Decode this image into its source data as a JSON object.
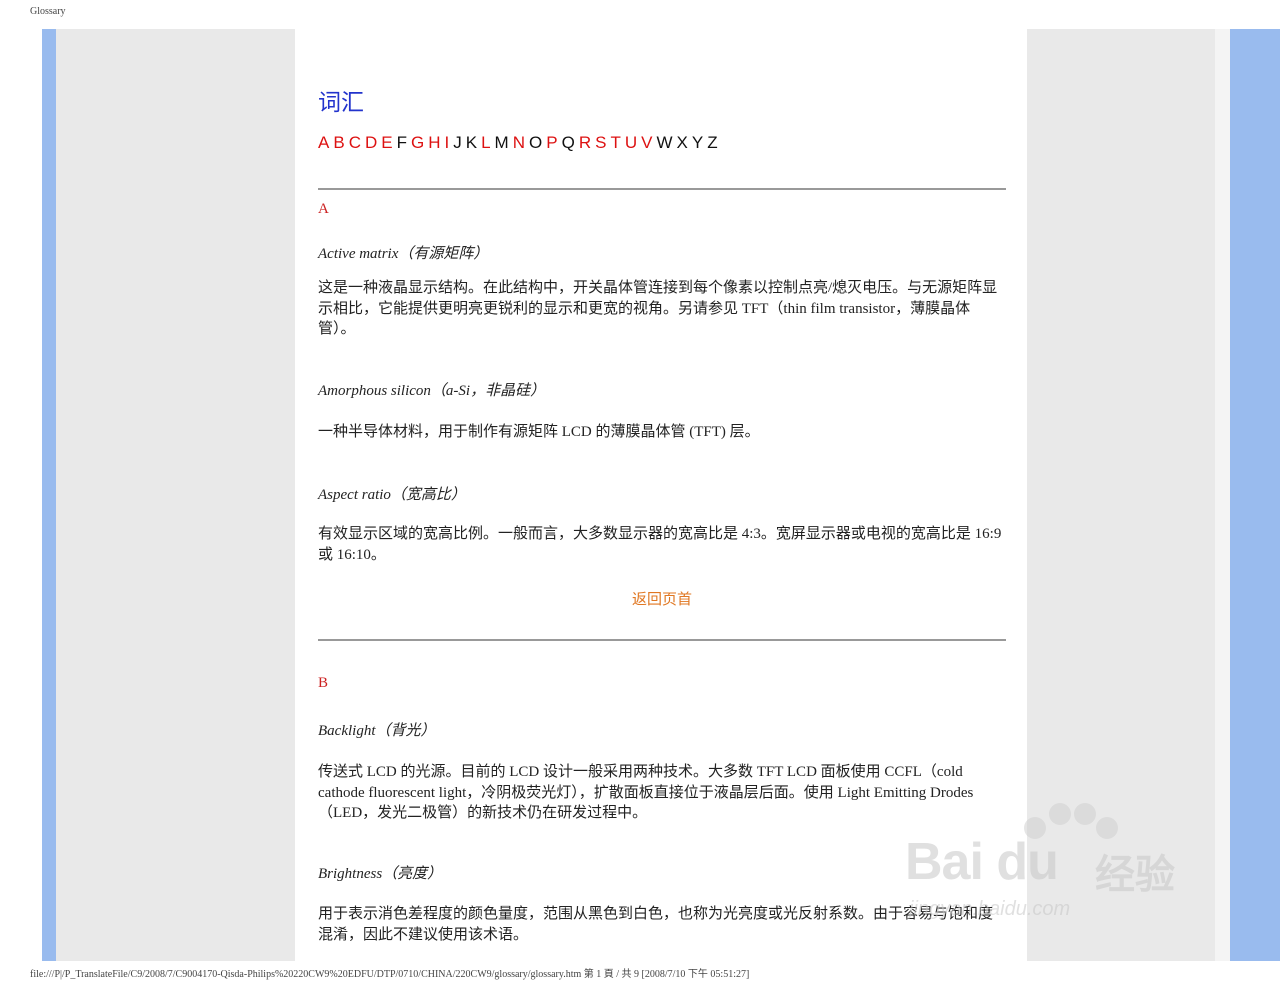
{
  "header": {
    "title": "Glossary"
  },
  "footer": {
    "text": "file:///P|/P_TranslateFile/C9/2008/7/C9004170-Qisda-Philips%20220CW9%20EDFU/DTP/0710/CHINA/220CW9/glossary/glossary.htm 第 1 頁 / 共 9  [2008/7/10 下午 05:51:27]"
  },
  "page": {
    "title": "词汇"
  },
  "alphabet": [
    {
      "l": "A",
      "link": true
    },
    {
      "l": "B",
      "link": true
    },
    {
      "l": "C",
      "link": true
    },
    {
      "l": "D",
      "link": true
    },
    {
      "l": "E",
      "link": true
    },
    {
      "l": "F",
      "link": false
    },
    {
      "l": "G",
      "link": true
    },
    {
      "l": "H",
      "link": true
    },
    {
      "l": "I",
      "link": true
    },
    {
      "l": "J",
      "link": false
    },
    {
      "l": "K",
      "link": false
    },
    {
      "l": "L",
      "link": true
    },
    {
      "l": "M",
      "link": false
    },
    {
      "l": "N",
      "link": true
    },
    {
      "l": "O",
      "link": false
    },
    {
      "l": "P",
      "link": true
    },
    {
      "l": "Q",
      "link": false
    },
    {
      "l": "R",
      "link": true
    },
    {
      "l": "S",
      "link": true
    },
    {
      "l": "T",
      "link": true
    },
    {
      "l": "U",
      "link": true
    },
    {
      "l": "V",
      "link": true
    },
    {
      "l": "W",
      "link": false
    },
    {
      "l": "X",
      "link": false
    },
    {
      "l": "Y",
      "link": false
    },
    {
      "l": "Z",
      "link": false
    }
  ],
  "colors": {
    "link": "#dd1111",
    "title": "#2233cc",
    "back_link": "#e07722",
    "side_bar": "#99bbee"
  },
  "sections": {
    "a": {
      "letter": "A",
      "terms": [
        {
          "term": "Active matrix（有源矩阵）",
          "def": "这是一种液晶显示结构。在此结构中，开关晶体管连接到每个像素以控制点亮/熄灭电压。与无源矩阵显示相比，它能提供更明亮更锐利的显示和更宽的视角。另请参见 TFT（thin film transistor，薄膜晶体管）。"
        },
        {
          "term": "Amorphous silicon（a-Si，非晶硅）",
          "def": "一种半导体材料，用于制作有源矩阵 LCD 的薄膜晶体管 (TFT) 层。"
        },
        {
          "term": "Aspect ratio（宽高比）",
          "def": "有效显示区域的宽高比例。一般而言，大多数显示器的宽高比是 4:3。宽屏显示器或电视的宽高比是 16:9 或 16:10。"
        }
      ],
      "back_to_top": "返回页首"
    },
    "b": {
      "letter": "B",
      "terms": [
        {
          "term": "Backlight（背光）",
          "def": "传送式 LCD 的光源。目前的 LCD 设计一般采用两种技术。大多数 TFT LCD 面板使用 CCFL（cold cathode fluorescent light，冷阴极荧光灯），扩散面板直接位于液晶层后面。使用 Light Emitting Drodes（LED，发光二极管）的新技术仍在研发过程中。"
        },
        {
          "term": "Brightness（亮度）",
          "def": "用于表示消色差程度的颜色量度，范围从黑色到白色，也称为光亮度或光反射系数。由于容易与饱和度混淆，因此不建议使用该术语。"
        }
      ]
    }
  },
  "watermark": {
    "brand": "Bai du",
    "cn": "经验",
    "url": "jingyan.baidu.com"
  }
}
